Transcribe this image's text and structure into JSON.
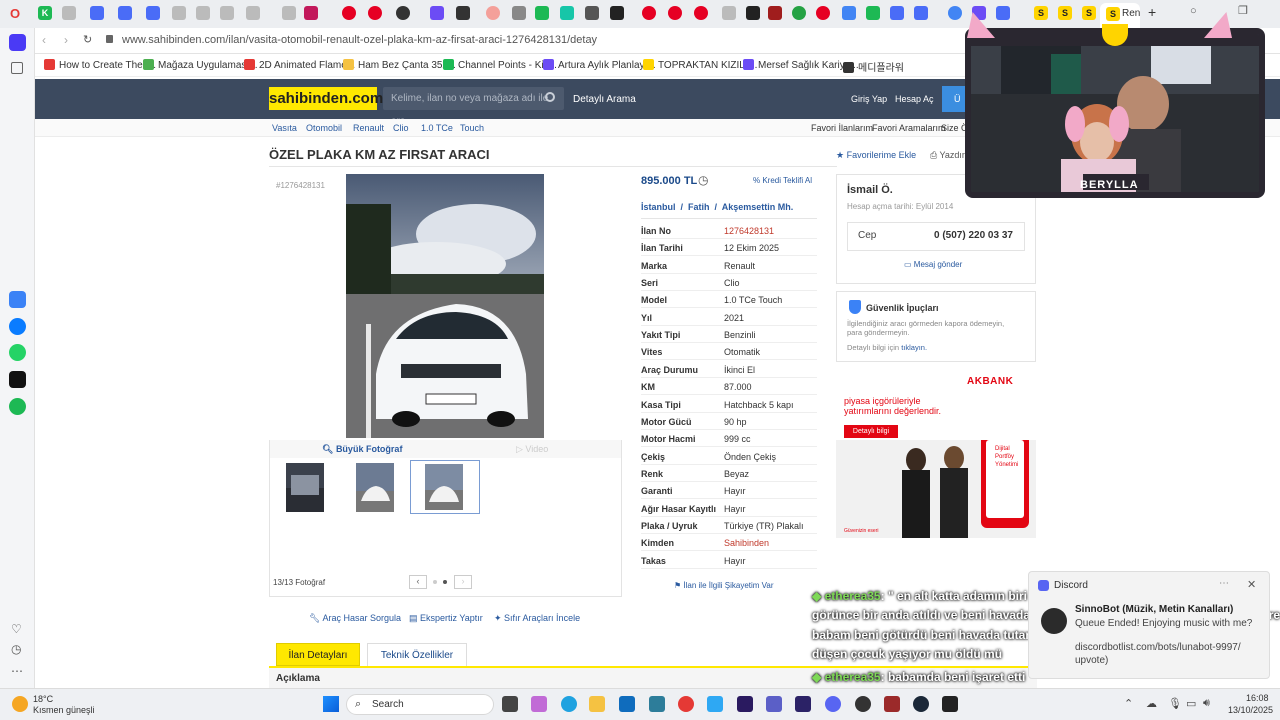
{
  "browser": {
    "url": "www.sahibinden.com/ilan/vasita-otomobil-renault-ozel-plaka-km-az-firsat-araci-1276428131/detay",
    "active_tab_label": "Ren"
  },
  "bookmarks": [
    {
      "label": "How to Create Thes...",
      "color": "#e53935"
    },
    {
      "label": "Mağaza Uygulaması...",
      "color": "#4caf50"
    },
    {
      "label": "2D Animated Flame...",
      "color": "#e53935"
    },
    {
      "label": "Ham Bez Çanta 35x...",
      "color": "#f5c242"
    },
    {
      "label": "Channel Points - Kic...",
      "color": "#1db954"
    },
    {
      "label": "Artura Aylık Planlayı...",
      "color": "#6c4cf5"
    },
    {
      "label": "TOPRAKTAN KIZILT...",
      "color": "#ffd400"
    },
    {
      "label": "Mersef Sağlık Kariye...",
      "color": "#6c4cf5"
    },
    {
      "label": "메디플라워",
      "color": "#333333"
    }
  ],
  "header": {
    "logo": "sahibinden.com",
    "search_placeholder": "Kelime, ilan no veya mağaza adı ile ara",
    "detailed_search": "Detaylı Arama",
    "login": "Giriş Yap",
    "register": "Hesap Aç",
    "post_ad": "Ü"
  },
  "breadcrumb": [
    "Vasıta",
    "Otomobil",
    "Renault",
    "Clio",
    "1.0 TCe",
    "Touch"
  ],
  "header_links": {
    "fav_listings": "Favori İlanlarım",
    "fav_searches": "Favori Aramalarım",
    "size_ozel": "Size Öz"
  },
  "listing": {
    "title": "ÖZEL PLAKA KM AZ FIRSAT ARACI",
    "id_tag": "#1276428131",
    "price": "895.000 TL",
    "credit_offer": "Kredi Teklifi Al",
    "location": [
      "İstanbul",
      "Fatih",
      "Akşemsettin Mh."
    ],
    "add_fav": "Favorilerime Ekle",
    "print": "Yazdır",
    "big_photo": "Büyük Fotoğraf",
    "video": "Video",
    "photo_count": "13/13 Fotoğraf",
    "complaint": "İlan ile İlgili Şikayetim Var"
  },
  "details": [
    {
      "k": "İlan No",
      "v": "1276428131",
      "red": true
    },
    {
      "k": "İlan Tarihi",
      "v": "12 Ekim 2025"
    },
    {
      "k": "Marka",
      "v": "Renault"
    },
    {
      "k": "Seri",
      "v": "Clio"
    },
    {
      "k": "Model",
      "v": "1.0 TCe Touch"
    },
    {
      "k": "Yıl",
      "v": "2021"
    },
    {
      "k": "Yakıt Tipi",
      "v": "Benzinli"
    },
    {
      "k": "Vites",
      "v": "Otomatik"
    },
    {
      "k": "Araç Durumu",
      "v": "İkinci El"
    },
    {
      "k": "KM",
      "v": "87.000"
    },
    {
      "k": "Kasa Tipi",
      "v": "Hatchback 5 kapı"
    },
    {
      "k": "Motor Gücü",
      "v": "90 hp"
    },
    {
      "k": "Motor Hacmi",
      "v": "999 cc"
    },
    {
      "k": "Çekiş",
      "v": "Önden Çekiş"
    },
    {
      "k": "Renk",
      "v": "Beyaz"
    },
    {
      "k": "Garanti",
      "v": "Hayır"
    },
    {
      "k": "Ağır Hasar Kayıtlı",
      "v": "Hayır"
    },
    {
      "k": "Plaka / Uyruk",
      "v": "Türkiye (TR) Plakalı"
    },
    {
      "k": "Kimden",
      "v": "Sahibinden",
      "red": true
    },
    {
      "k": "Takas",
      "v": "Hayır"
    }
  ],
  "actions": {
    "damage": "Araç Hasar Sorgula",
    "expertise": "Ekspertiz Yaptır",
    "similar": "Sıfır Araçları İncele"
  },
  "tabs": [
    "İlan Detayları",
    "Teknik Özellikler"
  ],
  "section_title": "Açıklama",
  "seller": {
    "name": "İsmail Ö.",
    "since": "Hesap açma tarihi: Eylül 2014",
    "phone_label": "Cep",
    "phone": "0 (507) 220 03 37",
    "message": "Mesaj gönder"
  },
  "safety": {
    "title": "Güvenlik İpuçları",
    "text1": "İlgilendiğiniz aracı görmeden kapora ödemeyin,",
    "text2": "para göndermeyin.",
    "more_pre": "Detaylı bilgi için ",
    "more_link": "tıklayın."
  },
  "ad": {
    "brand": "AKBANK",
    "line1": "piyasa içgörüleriyle",
    "line2": "yatırımlarını değerlendir.",
    "btn": "Detaylı bilgi",
    "phone_text1": "Dijital",
    "phone_text2": "Portföy",
    "phone_text3": "Yönetimi",
    "footer": "Güvenizin eseri"
  },
  "overlay": {
    "cam_name": "BERYLLA",
    "chat": [
      {
        "user": "etherea35",
        "text": ": \" en alt katta adamın biri yemek yiyordu benim düştüğümü"
      },
      {
        "user": "",
        "text": "görünce bir anda atıldı ve beni havada tuttu ama bir kaç gün sonra düştüğüm yere"
      },
      {
        "user": "",
        "text": "babam beni götürdü beni havada tutan adam babama sordu abi buraya geçen"
      },
      {
        "user": "",
        "text": "düşen çocuk yaşıyor mu öldü mü"
      },
      {
        "user": "etherea35",
        "text": ": babamda beni işaret etti"
      }
    ]
  },
  "discord": {
    "app": "Discord",
    "bot": "SinnoBot (Müzik, Metin Kanalları)",
    "msg1": "Queue Ended! Enjoying music with me?",
    "msg2": "discordbotlist.com/bots/lunabot-9997/",
    "msg3": "upvote)"
  },
  "taskbar": {
    "weather_temp": "18°C",
    "weather_desc": "Kısmen güneşli",
    "search": "Search",
    "time": "16:08",
    "date": "13/10/2025"
  }
}
